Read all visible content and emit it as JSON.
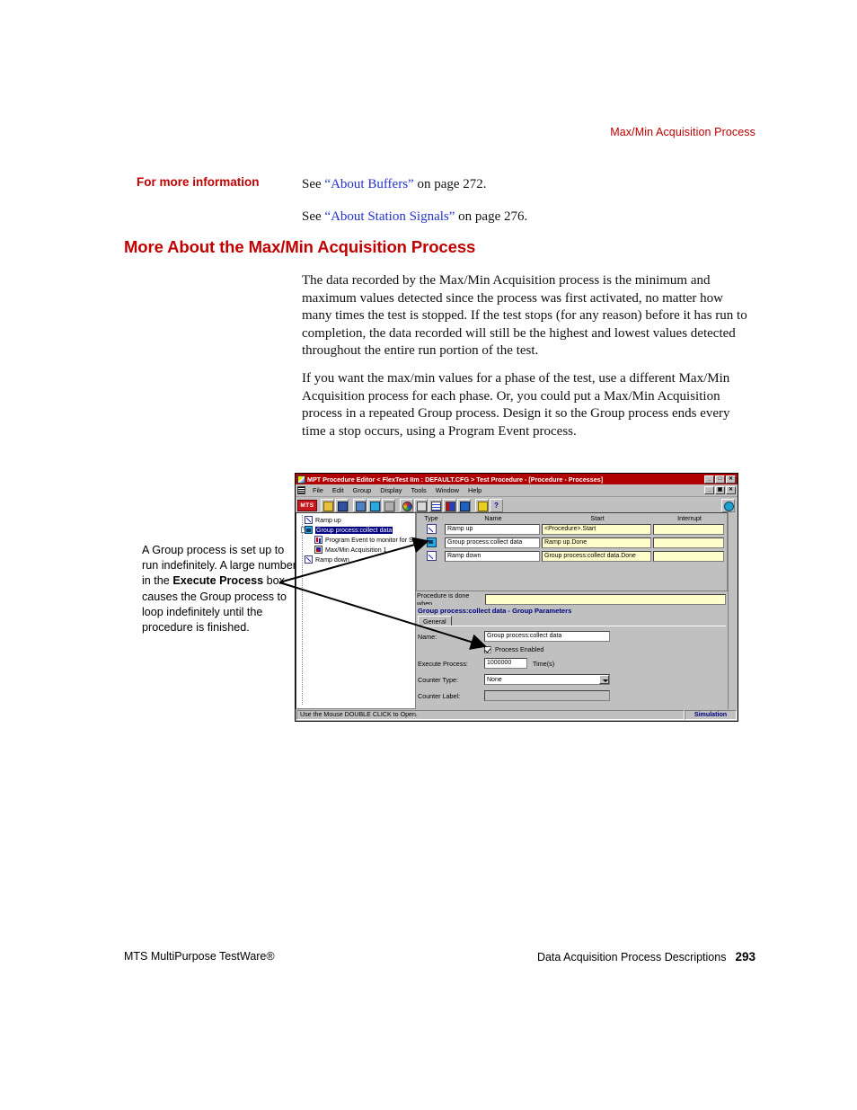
{
  "page": {
    "running_head": "Max/Min Acquisition Process",
    "margin_heading": "For more information",
    "section_heading": "More About the Max/Min Acquisition Process",
    "see_1_prefix": "See ",
    "see_1_link": "“About Buffers”",
    "see_1_suffix": " on page 272.",
    "see_2_prefix": "See ",
    "see_2_link": "“About Station Signals”",
    "see_2_suffix": " on page 276.",
    "paragraph_1": "The data recorded by the Max/Min Acquisition process is the minimum and maximum values detected since the process was first activated, no matter how many times the test is stopped. If the test stops (for any reason) before it has run to completion, the data recorded will still be the highest and lowest values detected throughout the entire run portion of the test.",
    "paragraph_2": "If you want the max/min values for a phase of the test, use a different Max/Min Acquisition process for each phase. Or, you could put a Max/Min Acquisition process in a repeated Group process. Design it so the Group process ends every time a stop occurs, using a Program Event process.",
    "callout": {
      "part_1": "A Group process is set up to run indefinitely. A large number in the ",
      "bold_1": "Execute Process",
      "part_2": " box causes the Group process to loop indefinitely until the procedure is finished."
    },
    "footer_left": "MTS MultiPurpose TestWare®",
    "footer_right": "Data Acquisition Process Descriptions",
    "footer_page": "293"
  },
  "colors": {
    "heading_red": "#c00000",
    "link_blue": "#2233cc",
    "titlebar_red": "#b00000",
    "window_gray": "#c0c0c0",
    "field_yellow": "#ffffcc",
    "params_title_blue": "#000080"
  },
  "app": {
    "title": "MPT Procedure Editor  < FlexTest IIm : DEFAULT.CFG >   Test Procedure - [Procedure - Processes]",
    "window_buttons": [
      "_",
      "□",
      "✕"
    ],
    "mdi_buttons": [
      "_",
      "▣",
      "✕"
    ],
    "menu": [
      "File",
      "Edit",
      "Group",
      "Display",
      "Tools",
      "Window",
      "Help"
    ],
    "toolbar": {
      "logo": "MTS",
      "buttons": [
        "open-folder-icon",
        "save-disk-icon",
        "insert-process-icon",
        "group-process-icon",
        "ungroup-icon",
        "palette-icon",
        "edit-chart-icon",
        "table-icon",
        "signals-icon",
        "monitor-icon",
        "lock-icon",
        "help-icon"
      ],
      "right_button": "refresh-icon"
    },
    "tree": [
      {
        "label": "Ramp up",
        "icon": "ramp-up-icon",
        "indent": 0,
        "expander": "",
        "selected": false
      },
      {
        "label": "Group process:collect data",
        "icon": "group-process-icon",
        "indent": 0,
        "expander": "-",
        "selected": true
      },
      {
        "label": "Program Event to monitor for Stop",
        "icon": "program-event-icon",
        "indent": 1,
        "expander": "",
        "selected": false
      },
      {
        "label": "Max/Min Acquisition 1",
        "icon": "maxmin-acquisition-icon",
        "indent": 1,
        "expander": "",
        "selected": false
      },
      {
        "label": "Ramp down",
        "icon": "ramp-down-icon",
        "indent": 0,
        "expander": "",
        "selected": false
      }
    ],
    "table": {
      "headers": [
        "Type",
        "Name",
        "Start",
        "Interrupt"
      ],
      "rows": [
        {
          "icon": "ramp-up-icon",
          "name": "Ramp up",
          "start": "<Procedure>.Start",
          "interrupt": ""
        },
        {
          "icon": "group-process-icon",
          "name": "Group process:collect data",
          "start": "Ramp up.Done",
          "interrupt": ""
        },
        {
          "icon": "ramp-down-icon",
          "name": "Ramp down",
          "start": "Group process:collect data.Done",
          "interrupt": ""
        }
      ]
    },
    "procedure_done": {
      "label": "Procedure is done when",
      "value": ""
    },
    "params": {
      "title": "Group process:collect data - Group Parameters",
      "tabs": [
        "General"
      ],
      "name_label": "Name:",
      "name_value": "Group process:collect data",
      "enabled_label": "Process Enabled",
      "enabled_checked": true,
      "execute_label": "Execute Process:",
      "execute_value": "1000000",
      "execute_units": "Time(s)",
      "counter_type_label": "Counter Type:",
      "counter_type_value": "None",
      "counter_label_label": "Counter Label:",
      "counter_label_value": ""
    },
    "statusbar": {
      "message": "Use the Mouse DOUBLE CLICK to Open.",
      "mode": "Simulation"
    }
  }
}
